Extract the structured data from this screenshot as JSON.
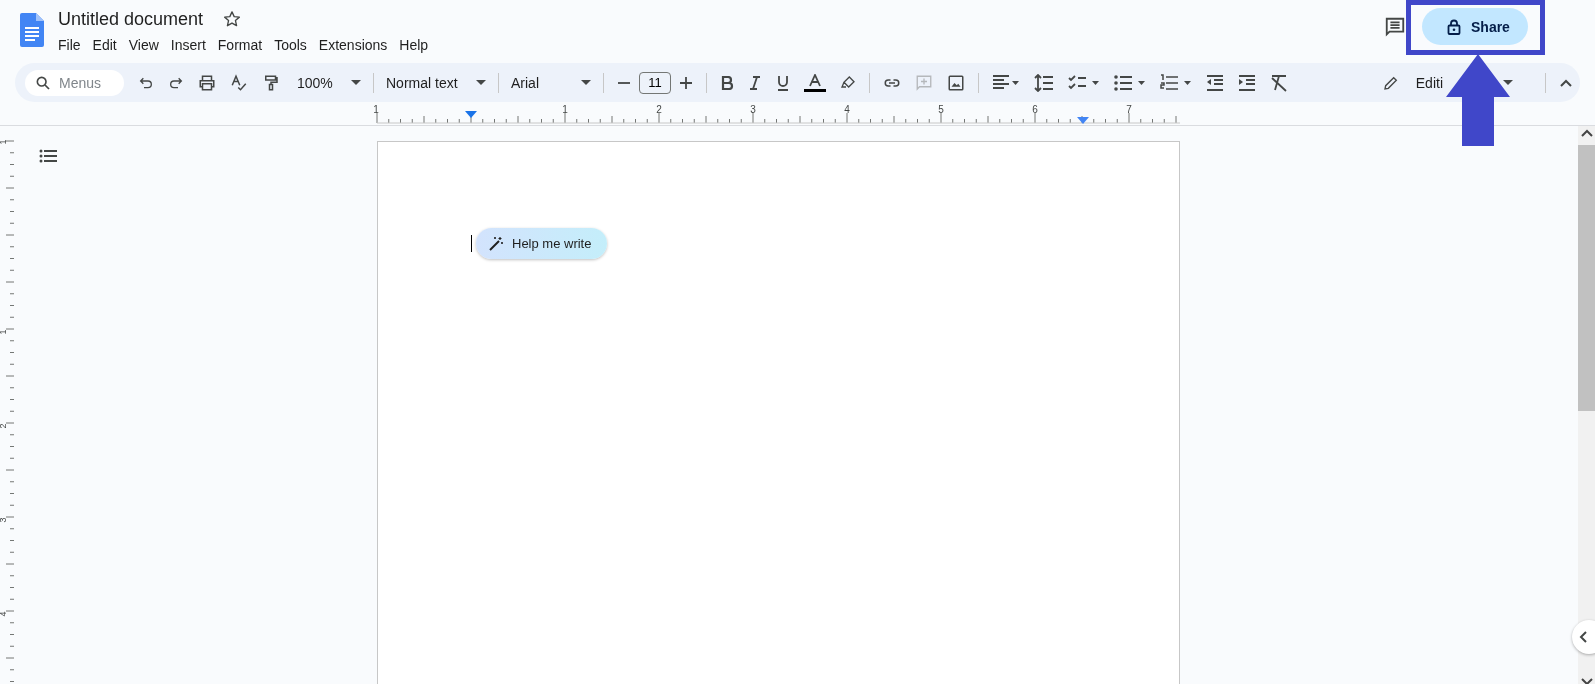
{
  "document": {
    "title": "Untitled document",
    "starred": false
  },
  "menu_bar": [
    "File",
    "Edit",
    "View",
    "Insert",
    "Format",
    "Tools",
    "Extensions",
    "Help"
  ],
  "header": {
    "share_label": "Share"
  },
  "toolbar": {
    "search_placeholder": "Menus",
    "zoom": "100%",
    "style": "Normal text",
    "font": "Arial",
    "font_size": "11",
    "add_comment_disabled": true,
    "mode": "Editi"
  },
  "ruler": {
    "horizontal_numbers": [
      "1",
      "1",
      "2",
      "3",
      "4",
      "5",
      "6",
      "7"
    ],
    "vertical_numbers": [
      "1",
      "1",
      "2",
      "3",
      "4"
    ]
  },
  "editor": {
    "help_chip": "Help me write"
  }
}
